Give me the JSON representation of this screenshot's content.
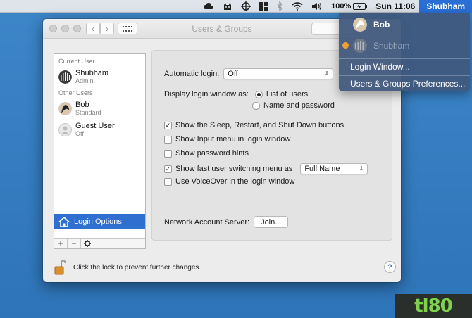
{
  "menubar": {
    "battery_percent": "100%",
    "clock": "Sun 11:06",
    "user_name": "Shubham",
    "icons": [
      "cloud-icon",
      "cat-icon",
      "crosshair-icon",
      "grid-icon",
      "bluetooth-icon",
      "wifi-icon",
      "volume-icon",
      "battery-icon"
    ]
  },
  "window": {
    "title": "Users & Groups",
    "sidebar": {
      "current_user_header": "Current User",
      "current_user": {
        "name": "Shubham",
        "role": "Admin"
      },
      "other_users_header": "Other Users",
      "other_users": [
        {
          "name": "Bob",
          "role": "Standard"
        },
        {
          "name": "Guest User",
          "role": "Off"
        }
      ],
      "login_options_label": "Login Options",
      "tools": [
        "+",
        "−",
        "gear"
      ]
    },
    "main": {
      "auto_login_label": "Automatic login:",
      "auto_login_value": "Off",
      "display_login_label": "Display login window as:",
      "display_options": [
        {
          "label": "List of users",
          "selected": true
        },
        {
          "label": "Name and password",
          "selected": false
        }
      ],
      "checkboxes": [
        {
          "label": "Show the Sleep, Restart, and Shut Down buttons",
          "checked": true
        },
        {
          "label": "Show Input menu in login window",
          "checked": false
        },
        {
          "label": "Show password hints",
          "checked": false
        },
        {
          "label": "Show fast user switching menu as",
          "checked": true
        },
        {
          "label": "Use VoiceOver in the login window",
          "checked": false
        }
      ],
      "fast_switch_value": "Full Name",
      "network_label": "Network Account Server:",
      "join_label": "Join..."
    },
    "lock_text": "Click the lock to prevent further changes.",
    "help_label": "?"
  },
  "user_menu": {
    "users": [
      {
        "name": "Bob",
        "active": false
      },
      {
        "name": "Shubham",
        "active": true
      }
    ],
    "items": [
      "Login Window...",
      "Users & Groups Preferences..."
    ]
  },
  "watermark": "tl80",
  "colors": {
    "desktop": "#3d86c8",
    "selection": "#2f6fd0",
    "menu_bg": "#40587c",
    "active_dot": "#f0a030"
  }
}
